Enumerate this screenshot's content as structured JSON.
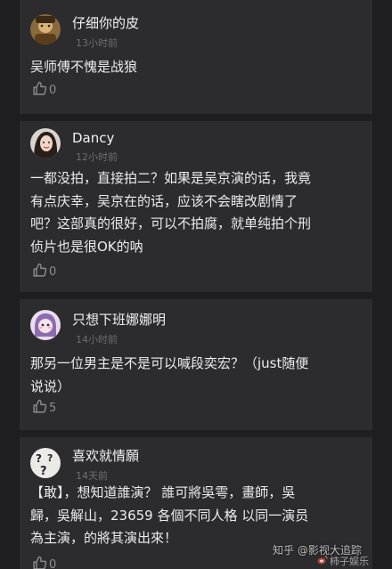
{
  "comments": [
    {
      "username": "仔细你的皮",
      "time": "13小时前",
      "text": "吴师傅不愧是战狼",
      "likes": "0"
    },
    {
      "username": "Dancy",
      "time": "12小时前",
      "text": "一都没拍，直接拍二？如果是吴京演的话，我竟\n有点庆幸，吴京在的话，应该不会瞎改剧情了\n吧？这部真的很好，可以不拍腐，就单纯拍个刑\n侦片也是很OK的呐",
      "likes": "0"
    },
    {
      "username": "只想下班娜娜明",
      "time": "14小时前",
      "text": "那另一位男主是不是可以喊段奕宏？（just随便\n说说）",
      "likes": "5"
    },
    {
      "username": "喜欢就情願",
      "time": "14天前",
      "text": "【敢】，想知道誰演？ 誰可將吳雩，畫師，吳\n歸，吳解山，23659 各個不同人格 以同一演员\n為主演，的將其演出來！",
      "likes": "0"
    }
  ],
  "watermarks": {
    "zhihu": "知乎 @影视大追踪",
    "weibo": "柿子娱乐"
  },
  "icons": {
    "like": "thumbs-up-icon",
    "weibo": "weibo-logo-icon"
  },
  "colors": {
    "background": "#1e1e20",
    "card": "#2c2c2f",
    "text": "#ececee",
    "muted": "#6d6d72"
  }
}
